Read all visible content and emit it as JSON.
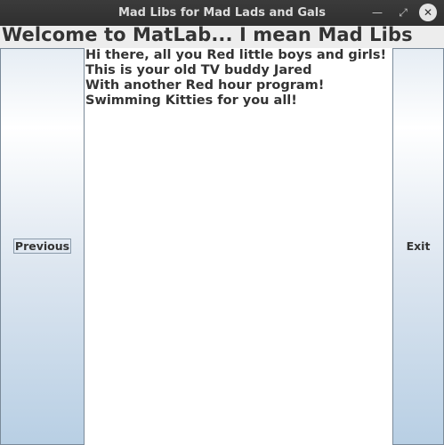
{
  "window": {
    "title": "Mad Libs for Mad Lads and Gals",
    "minimize_glyph": "—",
    "maximize_glyph": "⤢",
    "close_glyph": "✕"
  },
  "header": {
    "title": "Welcome to MatLab... I mean Mad Libs"
  },
  "buttons": {
    "previous_label": "Previous",
    "exit_label": "Exit"
  },
  "story": {
    "lines": [
      "Hi there, all you Red little boys and girls!",
      "This is your old TV buddy Jared",
      "With another Red hour program!",
      "Swimming Kitties for you all!"
    ]
  }
}
